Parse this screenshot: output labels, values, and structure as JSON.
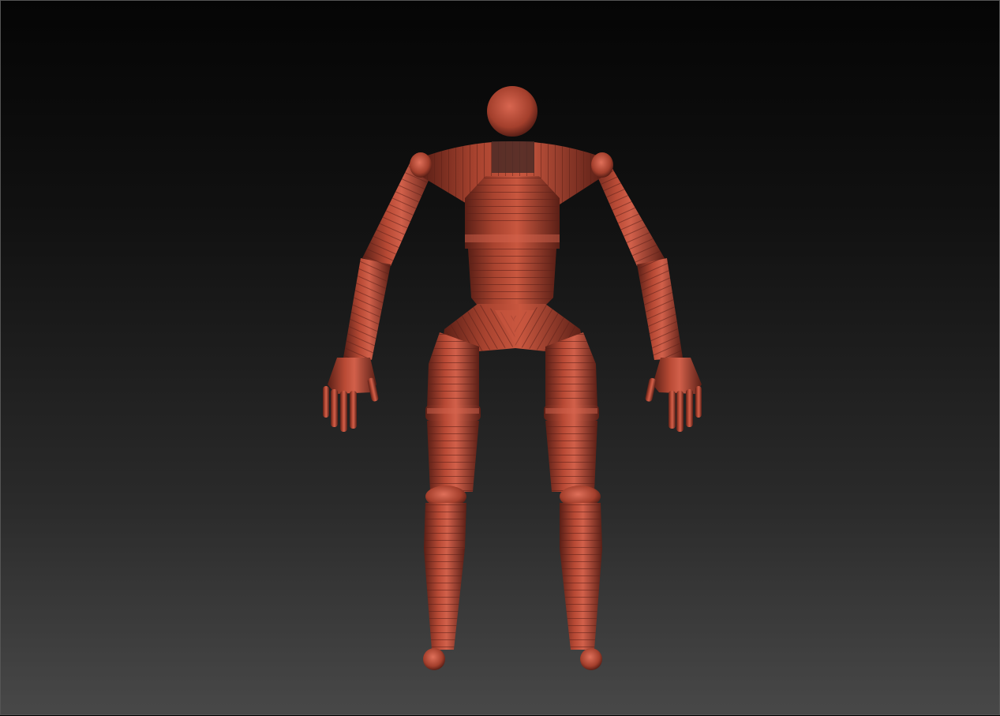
{
  "canvas": {
    "background_top": "#050505",
    "background_bottom": "#484848"
  },
  "model": {
    "material_color": "#b84a35",
    "highlight_color": "#e0705a",
    "shadow_color": "#5a1f16",
    "mask_color": "#4a2a26"
  }
}
